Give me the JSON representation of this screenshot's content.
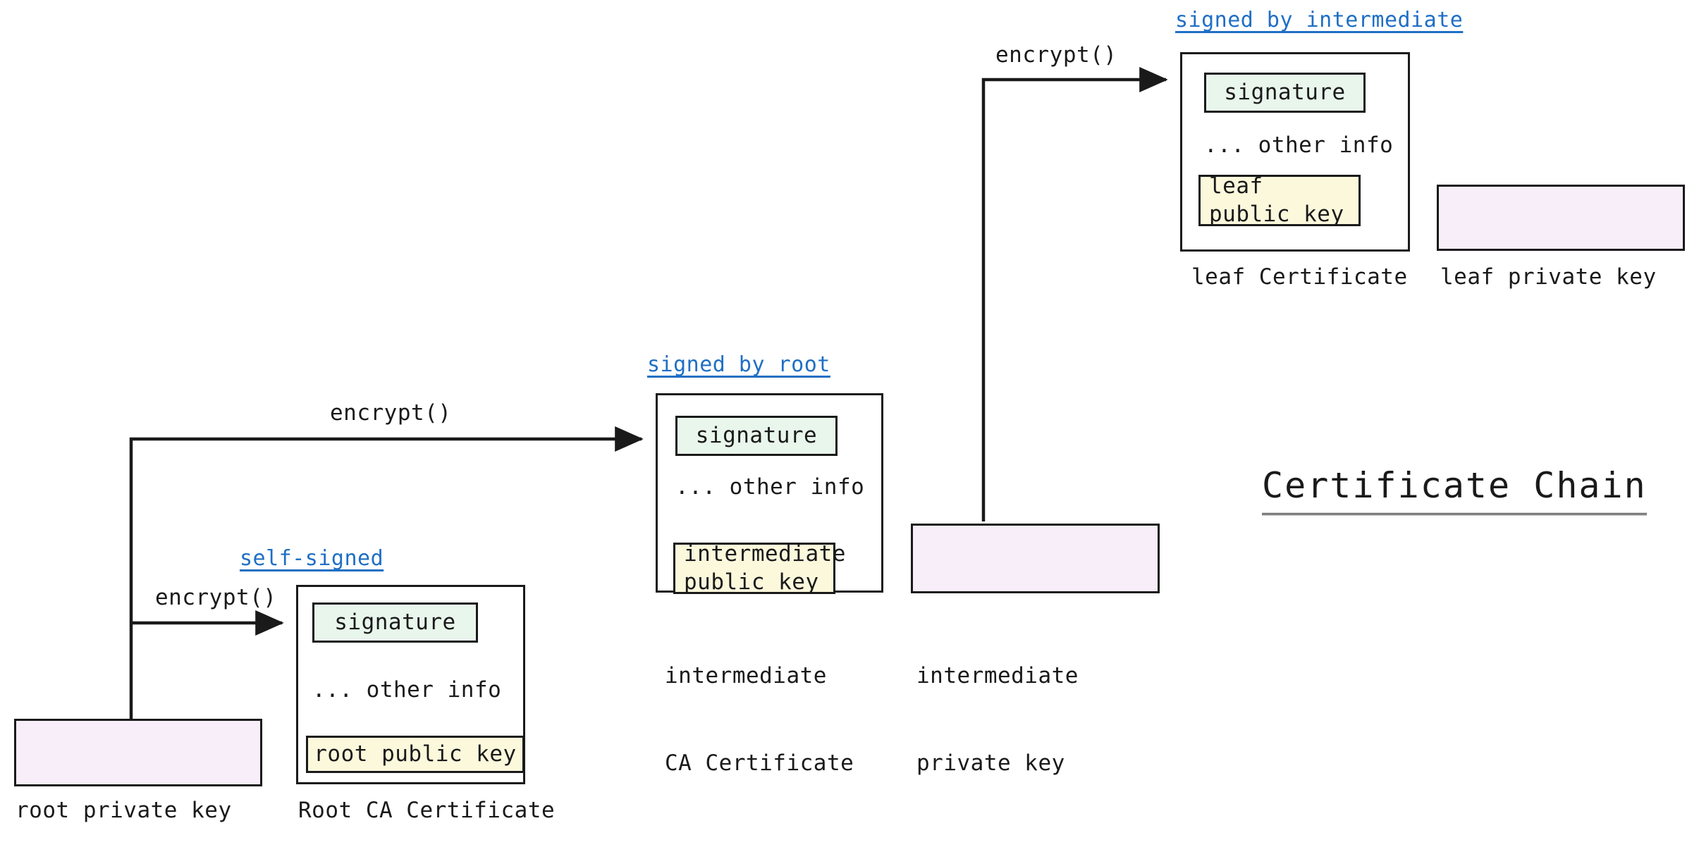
{
  "title": "Certificate Chain",
  "colors": {
    "signature_fill": "#e9f6ec",
    "publickey_fill": "#fcf8dc",
    "privatekey_fill": "#f7eefa",
    "stroke": "#1a1a1a",
    "annotation": "#1f6fc4",
    "background": "#ffffff"
  },
  "common": {
    "signature_label": "signature",
    "other_info_label": "... other info",
    "encrypt_label": "encrypt()"
  },
  "certificates": [
    {
      "id": "root",
      "annotation": "self-signed",
      "signature": "signature",
      "other_info": "... other info",
      "public_key": "root public key",
      "caption": "Root CA Certificate",
      "edge_label": "encrypt()"
    },
    {
      "id": "intermediate",
      "annotation": "signed by root",
      "signature": "signature",
      "other_info": "... other info",
      "public_key_line1": "intermediate",
      "public_key_line2": "public key",
      "caption_line1": "intermediate",
      "caption_line2": "CA Certificate",
      "edge_label": "encrypt()"
    },
    {
      "id": "leaf",
      "annotation": "signed by intermediate",
      "signature": "signature",
      "other_info": "... other info",
      "public_key_line1": "leaf",
      "public_key_line2": "public key",
      "caption": "leaf Certificate",
      "edge_label": "encrypt()"
    }
  ],
  "private_keys": [
    {
      "id": "root",
      "caption": "root private key"
    },
    {
      "id": "intermediate",
      "caption_line1": "intermediate",
      "caption_line2": "private key"
    },
    {
      "id": "leaf",
      "caption": "leaf private key"
    }
  ]
}
